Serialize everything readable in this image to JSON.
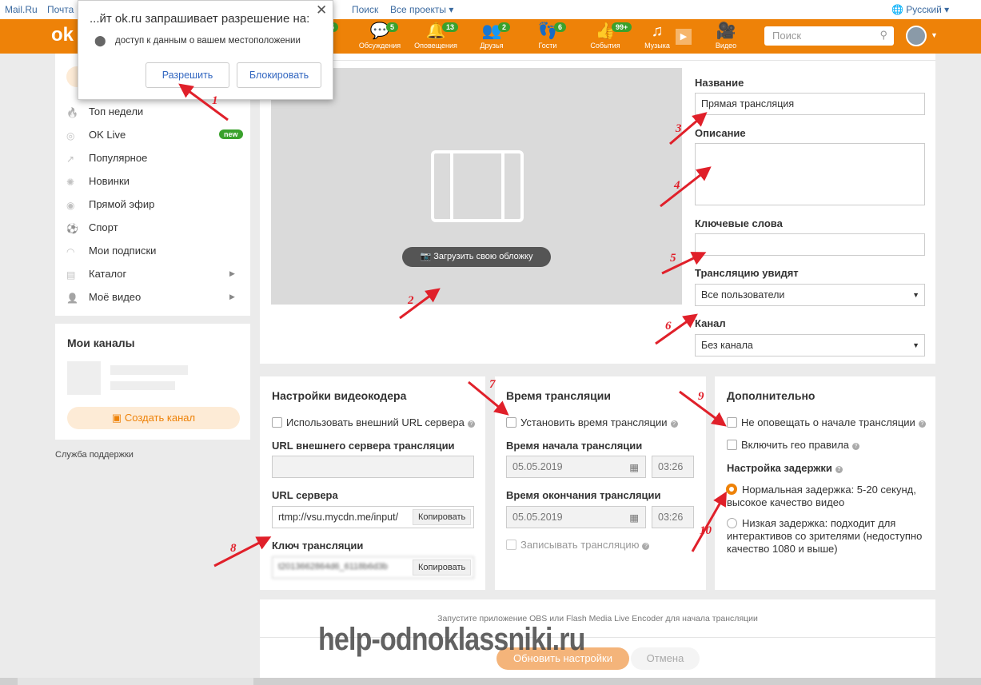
{
  "topbar": {
    "links": [
      "Mail.Ru",
      "Почта",
      "Поиск",
      "Все проекты ▾"
    ],
    "language": "Русский ▾"
  },
  "brand_color": "#ee8208",
  "nav": {
    "items": [
      {
        "label": "Обсуждения",
        "icon": "chat-icon",
        "badge": "5"
      },
      {
        "label": "Оповещения",
        "icon": "bell-icon",
        "badge": "13"
      },
      {
        "label": "Друзья",
        "icon": "friends-icon",
        "badge": "2"
      },
      {
        "label": "Гости",
        "icon": "footprints-icon",
        "badge": "6"
      },
      {
        "label": "События",
        "icon": "events-icon",
        "badge": "99+"
      },
      {
        "label": "Музыка",
        "icon": "music-icon",
        "badge": ""
      },
      {
        "label": "Видео",
        "icon": "video-camera-icon",
        "badge": ""
      }
    ],
    "first_badge": "5",
    "search_placeholder": "Поиск"
  },
  "popup": {
    "title": "...йт ok.ru запрашивает разрешение на:",
    "permission": "доступ к данным о вашем местоположении",
    "allow": "Разрешить",
    "block": "Блокировать"
  },
  "sidebar": {
    "items": [
      {
        "label": "Топ недели",
        "icon": "fire-icon"
      },
      {
        "label": "OK Live",
        "icon": "live-icon",
        "badge": "new"
      },
      {
        "label": "Популярное",
        "icon": "trending-icon"
      },
      {
        "label": "Новинки",
        "icon": "new-icon"
      },
      {
        "label": "Прямой эфир",
        "icon": "broadcast-icon"
      },
      {
        "label": "Спорт",
        "icon": "sport-icon"
      },
      {
        "label": "Мои подписки",
        "icon": "rss-icon"
      },
      {
        "label": "Каталог",
        "icon": "catalog-icon",
        "arrow": true
      },
      {
        "label": "Моё видео",
        "icon": "user-icon",
        "arrow": true
      }
    ],
    "channels_title": "Мои каналы",
    "create_channel": "Создать канал",
    "support": "Служба поддержки"
  },
  "preview": {
    "upload_cover": "Загрузить свою обложку"
  },
  "form": {
    "name_label": "Название",
    "name_value": "Прямая трансляция",
    "desc_label": "Описание",
    "desc_value": "",
    "keywords_label": "Ключевые слова",
    "keywords_value": "",
    "audience_label": "Трансляцию увидят",
    "audience_value": "Все пользователи",
    "channel_label": "Канал",
    "channel_value": "Без канала"
  },
  "encoder": {
    "title": "Настройки видеокодера",
    "use_external": "Использовать внешний URL сервера",
    "external_label": "URL внешнего сервера трансляции",
    "server_label": "URL сервера",
    "server_value": "rtmp://vsu.mycdn.me/input/",
    "copy": "Копировать",
    "key_label": "Ключ трансляции",
    "key_value": "t2013662864d6_6118b6d3b"
  },
  "time": {
    "title": "Время трансляции",
    "set_time": "Установить время трансляции",
    "start_label": "Время начала трансляции",
    "start_date": "05.05.2019",
    "start_time": "03:26",
    "end_label": "Время окончания трансляции",
    "end_date": "05.05.2019",
    "end_time": "03:26",
    "record": "Записывать трансляцию"
  },
  "extra": {
    "title": "Дополнительно",
    "no_notify": "Не оповещать о начале трансляции",
    "geo": "Включить гео правила",
    "delay_title": "Настройка задержки",
    "normal": "Нормальная задержка: 5-20 секунд, высокое качество видео",
    "low": "Низкая задержка: подходит для интерактивов со зрителями (недоступно качество 1080 и выше)",
    "selected_delay": "normal"
  },
  "footer": {
    "hint": "Запустите приложение OBS или Flash Media Live Encoder для начала трансляции",
    "update": "Обновить настройки",
    "cancel": "Отмена"
  },
  "watermark": "help-odnoklassniki.ru",
  "annotations": [
    "1",
    "2",
    "3",
    "4",
    "5",
    "6",
    "7",
    "8",
    "9",
    "10"
  ],
  "annotation_color": "#e0202a"
}
